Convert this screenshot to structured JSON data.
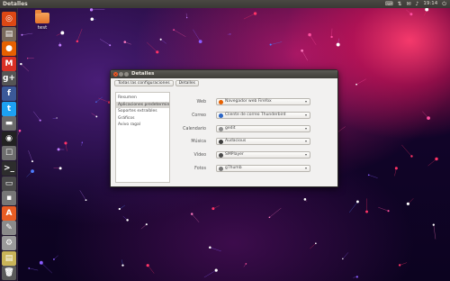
{
  "top_panel": {
    "title": "Detalles",
    "tray_icons": [
      "keyboard-icon",
      "network-icon",
      "mail-icon",
      "volume-icon"
    ],
    "clock": "19:14",
    "power_icon": "power-icon"
  },
  "launcher": {
    "apps": [
      {
        "name": "ubuntu-dash-icon",
        "glyph": "◎",
        "color": "#dd4814"
      },
      {
        "name": "files-icon",
        "glyph": "▤",
        "color": "#7a6a5c"
      },
      {
        "name": "firefox-icon",
        "glyph": "●",
        "color": "#e66000"
      },
      {
        "name": "gmail-icon",
        "glyph": "M",
        "color": "#d93025"
      },
      {
        "name": "google-plus-icon",
        "glyph": "g+",
        "color": "#555"
      },
      {
        "name": "facebook-icon",
        "glyph": "f",
        "color": "#3b5998"
      },
      {
        "name": "twitter-icon",
        "glyph": "t",
        "color": "#1da1f2"
      },
      {
        "name": "drive-icon",
        "glyph": "▬",
        "color": "#6b6b6b"
      },
      {
        "name": "music-icon",
        "glyph": "◉",
        "color": "#222"
      },
      {
        "name": "chat-icon",
        "glyph": "☐",
        "color": "#6e6e6e"
      },
      {
        "name": "terminal-icon",
        "glyph": ">_",
        "color": "#2d2d2d"
      },
      {
        "name": "monitor-icon",
        "glyph": "▭",
        "color": "#4a4a4a"
      },
      {
        "name": "disk-icon",
        "glyph": "▪",
        "color": "#777"
      },
      {
        "name": "software-center-icon",
        "glyph": "A",
        "color": "#e85d24"
      },
      {
        "name": "editor-icon",
        "glyph": "✎",
        "color": "#8a8a8a"
      },
      {
        "name": "settings-icon",
        "glyph": "⚙",
        "color": "#9a9a9a"
      },
      {
        "name": "notes-icon",
        "glyph": "▤",
        "color": "#c9b458"
      },
      {
        "name": "trash-icon",
        "glyph": "🗑",
        "color": "#5a5a5a"
      }
    ]
  },
  "desktop": {
    "folder_label": "test"
  },
  "window": {
    "title": "Detalles",
    "toolbar": {
      "all_settings": "Todas las configuraciones",
      "details": "Detalles"
    },
    "sidebar": [
      {
        "label": "Resumen",
        "selected": false
      },
      {
        "label": "Aplicaciones predetermin...",
        "selected": true
      },
      {
        "label": "Soportes extraíbles",
        "selected": false
      },
      {
        "label": "Gráficos",
        "selected": false
      },
      {
        "label": "Avivo ragal",
        "selected": false
      }
    ],
    "defaults": [
      {
        "label": "Web",
        "value": "Navegador web Firefox",
        "icon": "firefox-icon",
        "color": "#e66000"
      },
      {
        "label": "Correo",
        "value": "Cliente de correo Thunderbird",
        "icon": "thunderbird-icon",
        "color": "#2a64c4"
      },
      {
        "label": "Calendario",
        "value": "gedit",
        "icon": "gedit-icon",
        "color": "#8b8b8b"
      },
      {
        "label": "Música",
        "value": "Audacious",
        "icon": "audacious-icon",
        "color": "#3c3c3c"
      },
      {
        "label": "Vídeo",
        "value": "SMPlayer",
        "icon": "smplayer-icon",
        "color": "#4a4a4a"
      },
      {
        "label": "Fotos",
        "value": "gThumb",
        "icon": "gthumb-icon",
        "color": "#777777"
      }
    ]
  }
}
